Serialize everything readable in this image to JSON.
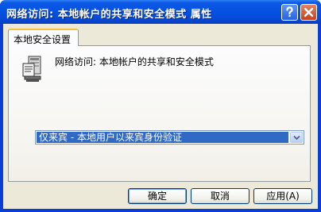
{
  "window": {
    "title": "网络访问: 本地帐户的共享和安全模式 属性"
  },
  "tabs": [
    {
      "label": "本地安全设置",
      "active": true
    }
  ],
  "policy": {
    "icon": "policy-computer-icon",
    "name": "网络访问: 本地帐户的共享和安全模式"
  },
  "dropdown": {
    "selected": "仅来宾 - 本地用户以来宾身份验证"
  },
  "buttons": {
    "ok": "确定",
    "cancel": "取消",
    "apply": "应用(A)"
  },
  "colors": {
    "titlebar": "#0550e0",
    "selection": "#316ac5",
    "dialog_bg": "#ece9d8"
  }
}
